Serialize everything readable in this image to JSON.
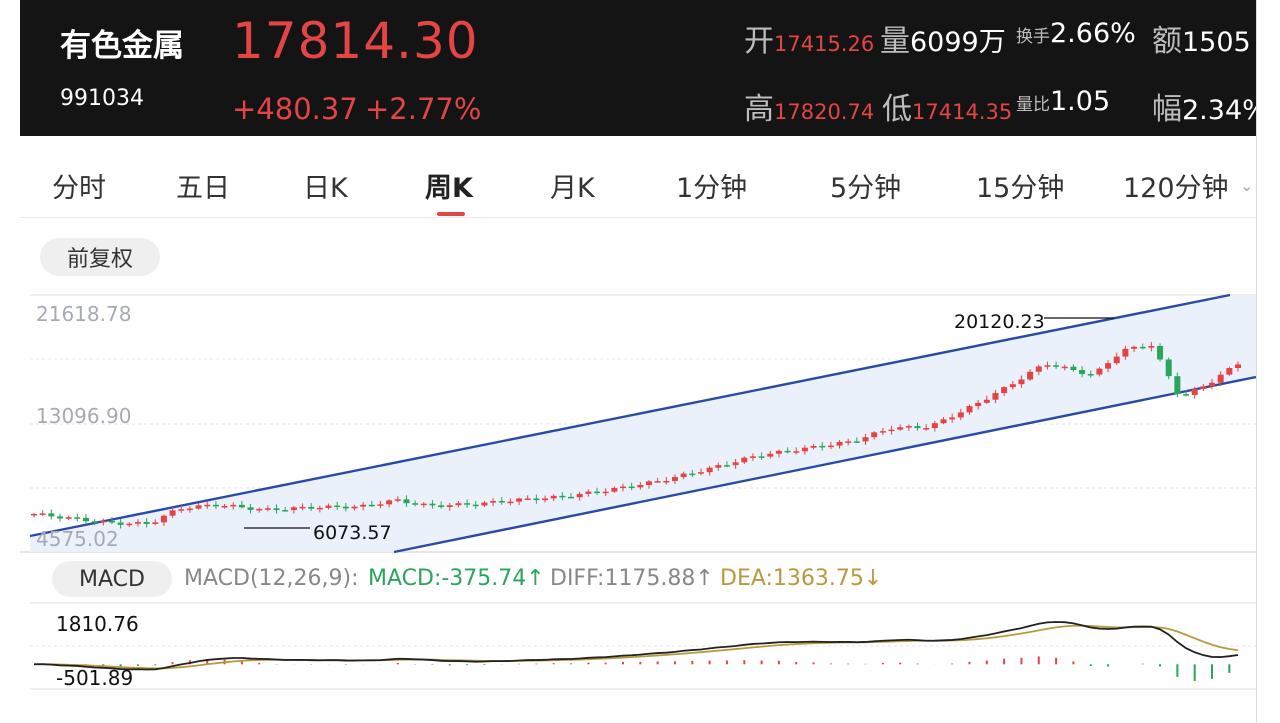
{
  "header": {
    "name": "有色金属",
    "code": "991034",
    "price": "17814.30",
    "change": "+480.37",
    "change_pct": "+2.77%",
    "open_label": "开",
    "open_value": "17415.26",
    "vol_label": "量",
    "vol_value": "6099万",
    "turnover_label": "换手",
    "turnover_value": "2.66%",
    "amount_label": "额",
    "amount_value": "1505",
    "high_label": "高",
    "high_value": "17820.74",
    "low_label": "低",
    "low_value": "17414.35",
    "volratio_label": "量比",
    "volratio_value": "1.05",
    "amp_label": "幅",
    "amp_value": "2.34%"
  },
  "tabs": [
    "分时",
    "五日",
    "日K",
    "周K",
    "月K",
    "1分钟",
    "5分钟",
    "15分钟",
    "120分钟"
  ],
  "active_tab": "周K",
  "adjust_label": "前复权",
  "chart": {
    "y_labels": [
      "21618.78",
      "13096.90",
      "4575.02"
    ],
    "max_label": "20120.23",
    "min_label": "6073.57"
  },
  "macd": {
    "pill": "MACD",
    "params": "MACD(12,26,9):",
    "macd_text": "MACD:-375.74",
    "diff_text": "DIFF:1175.88",
    "dea_text": "DEA:1363.75",
    "top_label": "1810.76",
    "bottom_label": "-501.89"
  },
  "colors": {
    "up": "#e34545",
    "down": "#2aa55a",
    "channel": "#2b4aa5",
    "channel_fill": "#eaf1fb",
    "dea": "#b89a3e",
    "header_bg": "#141414"
  },
  "icons": {
    "more_tabs": "chevron-down-icon",
    "macd_up": "arrow-up-icon",
    "macd_down": "arrow-down-icon"
  }
}
